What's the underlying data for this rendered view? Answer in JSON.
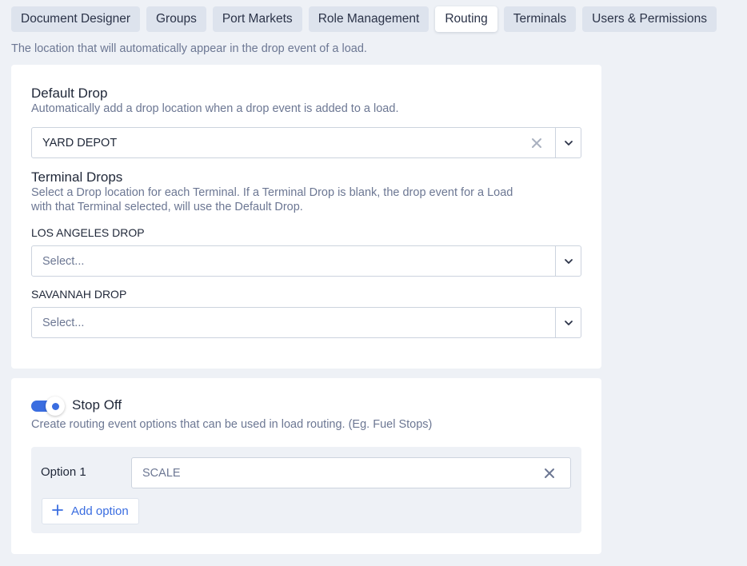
{
  "tabs": [
    {
      "label": "Document Designer",
      "active": false
    },
    {
      "label": "Groups",
      "active": false
    },
    {
      "label": "Port Markets",
      "active": false
    },
    {
      "label": "Role Management",
      "active": false
    },
    {
      "label": "Routing",
      "active": true
    },
    {
      "label": "Terminals",
      "active": false
    },
    {
      "label": "Users & Permissions",
      "active": false
    }
  ],
  "page_description": "The location that will automatically appear in the drop event of a load.",
  "default_drop": {
    "title": "Default Drop",
    "subtitle": "Automatically add a drop location when a drop event is added to a load.",
    "selected_value": "YARD DEPOT"
  },
  "terminal_drops": {
    "title": "Terminal Drops",
    "subtitle_line1": "Select a Drop location for each Terminal. If a Terminal Drop is blank, the drop event for a Load",
    "subtitle_line2": "with that Terminal selected, will use the Default Drop.",
    "fields": [
      {
        "label": "LOS ANGELES DROP",
        "placeholder": "Select..."
      },
      {
        "label": "SAVANNAH DROP",
        "placeholder": "Select..."
      }
    ]
  },
  "stop_off": {
    "enabled": true,
    "title": "Stop Off",
    "subtitle": "Create routing event options that can be used in load routing. (Eg. Fuel Stops)",
    "options": [
      {
        "label": "Option 1",
        "value": "SCALE"
      }
    ],
    "add_label": "Add option"
  },
  "colors": {
    "accent": "#3a6de0",
    "background": "#eef1f6",
    "tab_inactive": "#dde3ed",
    "muted_text": "#6c7793"
  },
  "icons": {
    "clear": "close-icon",
    "dropdown": "chevron-down-icon",
    "add": "plus-icon"
  }
}
